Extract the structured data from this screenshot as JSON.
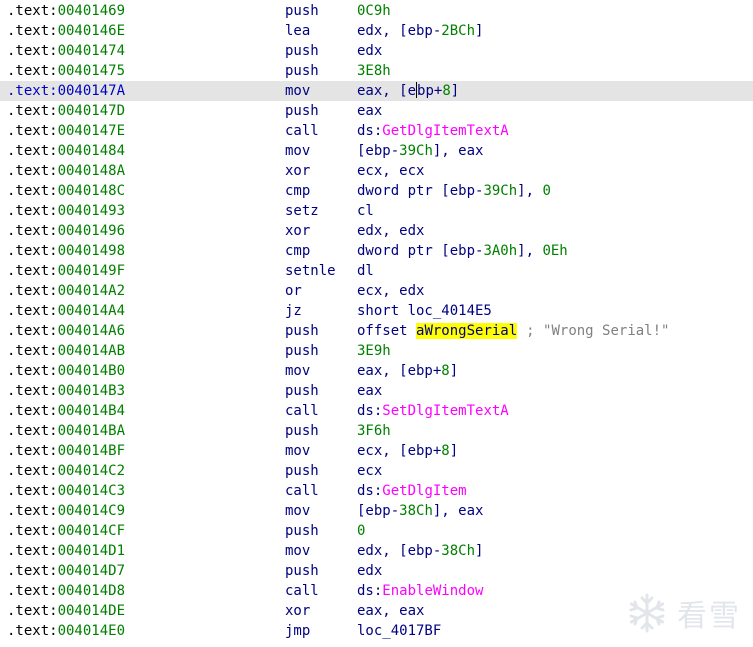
{
  "segment": ".text:",
  "selected_row_index": 4,
  "rows": [
    {
      "addr": "00401469",
      "mnem": "push",
      "ops": [
        {
          "t": "0C9h",
          "c": "num"
        }
      ]
    },
    {
      "addr": "0040146E",
      "mnem": "lea",
      "ops": [
        {
          "t": "edx, [ebp-"
        },
        {
          "t": "2BCh",
          "c": "num"
        },
        {
          "t": "]"
        }
      ]
    },
    {
      "addr": "00401474",
      "mnem": "push",
      "ops": [
        {
          "t": "edx"
        }
      ]
    },
    {
      "addr": "00401475",
      "mnem": "push",
      "ops": [
        {
          "t": "3E8h",
          "c": "num"
        }
      ]
    },
    {
      "addr": "0040147A",
      "mnem": "mov",
      "ops": [
        {
          "t": "eax, [e"
        },
        {
          "t": "",
          "c": "caret"
        },
        {
          "t": "bp+"
        },
        {
          "t": "8",
          "c": "num"
        },
        {
          "t": "]"
        }
      ]
    },
    {
      "addr": "0040147D",
      "mnem": "push",
      "ops": [
        {
          "t": "eax"
        }
      ]
    },
    {
      "addr": "0040147E",
      "mnem": "call",
      "ops": [
        {
          "t": "ds:"
        },
        {
          "t": "GetDlgItemTextA",
          "c": "api"
        }
      ]
    },
    {
      "addr": "00401484",
      "mnem": "mov",
      "ops": [
        {
          "t": "[ebp-"
        },
        {
          "t": "39Ch",
          "c": "num"
        },
        {
          "t": "], eax"
        }
      ]
    },
    {
      "addr": "0040148A",
      "mnem": "xor",
      "ops": [
        {
          "t": "ecx, ecx"
        }
      ]
    },
    {
      "addr": "0040148C",
      "mnem": "cmp",
      "ops": [
        {
          "t": "dword ptr [ebp-"
        },
        {
          "t": "39Ch",
          "c": "num"
        },
        {
          "t": "], "
        },
        {
          "t": "0",
          "c": "num"
        }
      ]
    },
    {
      "addr": "00401493",
      "mnem": "setz",
      "ops": [
        {
          "t": "cl"
        }
      ]
    },
    {
      "addr": "00401496",
      "mnem": "xor",
      "ops": [
        {
          "t": "edx, edx"
        }
      ]
    },
    {
      "addr": "00401498",
      "mnem": "cmp",
      "ops": [
        {
          "t": "dword ptr [ebp-"
        },
        {
          "t": "3A0h",
          "c": "num"
        },
        {
          "t": "], "
        },
        {
          "t": "0Eh",
          "c": "num"
        }
      ]
    },
    {
      "addr": "0040149F",
      "mnem": "setnle",
      "ops": [
        {
          "t": "dl"
        }
      ]
    },
    {
      "addr": "004014A2",
      "mnem": "or",
      "ops": [
        {
          "t": "ecx, edx"
        }
      ]
    },
    {
      "addr": "004014A4",
      "mnem": "jz",
      "ops": [
        {
          "t": "short loc_4014E5"
        }
      ]
    },
    {
      "addr": "004014A6",
      "mnem": "push",
      "ops": [
        {
          "t": "offset "
        },
        {
          "t": "aWrongSerial",
          "c": "hl"
        },
        {
          "t": "; \"Wrong Serial!\"",
          "c": "cmt"
        }
      ]
    },
    {
      "addr": "004014AB",
      "mnem": "push",
      "ops": [
        {
          "t": "3E9h",
          "c": "num"
        }
      ]
    },
    {
      "addr": "004014B0",
      "mnem": "mov",
      "ops": [
        {
          "t": "eax, [ebp+"
        },
        {
          "t": "8",
          "c": "num"
        },
        {
          "t": "]"
        }
      ]
    },
    {
      "addr": "004014B3",
      "mnem": "push",
      "ops": [
        {
          "t": "eax"
        }
      ]
    },
    {
      "addr": "004014B4",
      "mnem": "call",
      "ops": [
        {
          "t": "ds:"
        },
        {
          "t": "SetDlgItemTextA",
          "c": "api"
        }
      ]
    },
    {
      "addr": "004014BA",
      "mnem": "push",
      "ops": [
        {
          "t": "3F6h",
          "c": "num"
        }
      ]
    },
    {
      "addr": "004014BF",
      "mnem": "mov",
      "ops": [
        {
          "t": "ecx, [ebp+"
        },
        {
          "t": "8",
          "c": "num"
        },
        {
          "t": "]"
        }
      ]
    },
    {
      "addr": "004014C2",
      "mnem": "push",
      "ops": [
        {
          "t": "ecx"
        }
      ]
    },
    {
      "addr": "004014C3",
      "mnem": "call",
      "ops": [
        {
          "t": "ds:"
        },
        {
          "t": "GetDlgItem",
          "c": "api"
        }
      ]
    },
    {
      "addr": "004014C9",
      "mnem": "mov",
      "ops": [
        {
          "t": "[ebp-"
        },
        {
          "t": "38Ch",
          "c": "num"
        },
        {
          "t": "], eax"
        }
      ]
    },
    {
      "addr": "004014CF",
      "mnem": "push",
      "ops": [
        {
          "t": "0",
          "c": "num"
        }
      ]
    },
    {
      "addr": "004014D1",
      "mnem": "mov",
      "ops": [
        {
          "t": "edx, [ebp-"
        },
        {
          "t": "38Ch",
          "c": "num"
        },
        {
          "t": "]"
        }
      ]
    },
    {
      "addr": "004014D7",
      "mnem": "push",
      "ops": [
        {
          "t": "edx"
        }
      ]
    },
    {
      "addr": "004014D8",
      "mnem": "call",
      "ops": [
        {
          "t": "ds:"
        },
        {
          "t": "EnableWindow",
          "c": "api"
        }
      ]
    },
    {
      "addr": "004014DE",
      "mnem": "xor",
      "ops": [
        {
          "t": "eax, eax"
        }
      ]
    },
    {
      "addr": "004014E0",
      "mnem": "jmp",
      "ops": [
        {
          "t": "loc_4017BF"
        }
      ]
    }
  ],
  "watermark": {
    "icon": "snowflake-icon",
    "text": "看雪"
  },
  "colors": {
    "address": "#008000",
    "selected_address": "#0000c0",
    "instruction": "#000080",
    "number": "#008000",
    "api": "#ff00ff",
    "highlight": "#ffff00",
    "comment": "#808080",
    "selected_row_bg": "#e4e4e4"
  }
}
